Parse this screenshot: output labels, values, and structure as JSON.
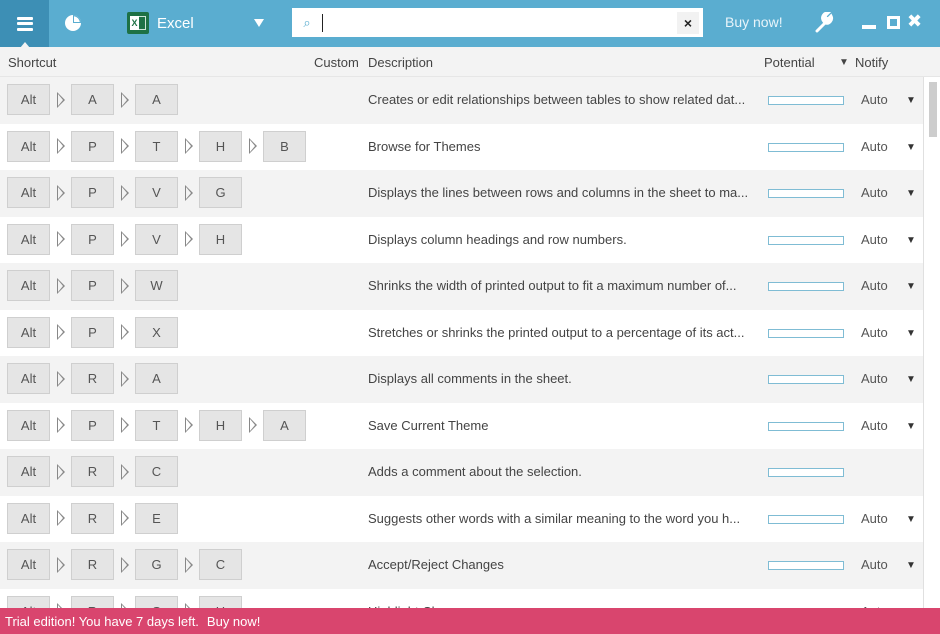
{
  "titlebar": {
    "app_name": "Excel",
    "search_value": "",
    "search_placeholder": "",
    "clear_icon": "×",
    "buy_now": "Buy now!",
    "search_icon": "⌕",
    "wrench_icon": "🔧",
    "close_icon": "✖"
  },
  "colors": {
    "accent": "#5aadd0",
    "menu_bg": "#3d8fb5",
    "trial_bg": "#d9456e",
    "excel_green": "#1e7145"
  },
  "columns": {
    "shortcut": "Shortcut",
    "custom": "Custom",
    "description": "Description",
    "potential": "Potential",
    "notify_sort_icon": "▼",
    "notify": "Notify"
  },
  "rows": [
    {
      "keys": [
        "Alt",
        "A",
        "A"
      ],
      "description": "Creates or edit relationships between tables to show related dat...",
      "potential": 0,
      "notify": "Auto"
    },
    {
      "keys": [
        "Alt",
        "P",
        "T",
        "H",
        "B"
      ],
      "description": "Browse for Themes",
      "potential": 0,
      "notify": "Auto"
    },
    {
      "keys": [
        "Alt",
        "P",
        "V",
        "G"
      ],
      "description": "Displays the lines between rows and columns in the sheet to ma...",
      "potential": 0,
      "notify": "Auto"
    },
    {
      "keys": [
        "Alt",
        "P",
        "V",
        "H"
      ],
      "description": "Displays column headings and row numbers.",
      "potential": 0,
      "notify": "Auto"
    },
    {
      "keys": [
        "Alt",
        "P",
        "W"
      ],
      "description": "Shrinks the width of printed output to fit a maximum number of...",
      "potential": 0,
      "notify": "Auto"
    },
    {
      "keys": [
        "Alt",
        "P",
        "X"
      ],
      "description": "Stretches or shrinks the printed output to a percentage of its act...",
      "potential": 0,
      "notify": "Auto"
    },
    {
      "keys": [
        "Alt",
        "R",
        "A"
      ],
      "description": "Displays all comments in the sheet.",
      "potential": 0,
      "notify": "Auto"
    },
    {
      "keys": [
        "Alt",
        "P",
        "T",
        "H",
        "A"
      ],
      "description": "Save Current Theme",
      "potential": 0,
      "notify": "Auto"
    },
    {
      "keys": [
        "Alt",
        "R",
        "C"
      ],
      "description": "Adds a comment about the selection.",
      "potential": 0,
      "notify": ""
    },
    {
      "keys": [
        "Alt",
        "R",
        "E"
      ],
      "description": "Suggests other words with a similar meaning to the word you h...",
      "potential": 0,
      "notify": "Auto"
    },
    {
      "keys": [
        "Alt",
        "R",
        "G",
        "C"
      ],
      "description": "Accept/Reject Changes",
      "potential": 0,
      "notify": "Auto"
    },
    {
      "keys": [
        "Alt",
        "R",
        "G",
        "H"
      ],
      "description": "Highlight Changes",
      "potential": 0,
      "notify": "Auto"
    }
  ],
  "notify_caret": "▼",
  "trial": {
    "message": "Trial edition! You have 7 days left.",
    "buy_now": "Buy now!"
  }
}
